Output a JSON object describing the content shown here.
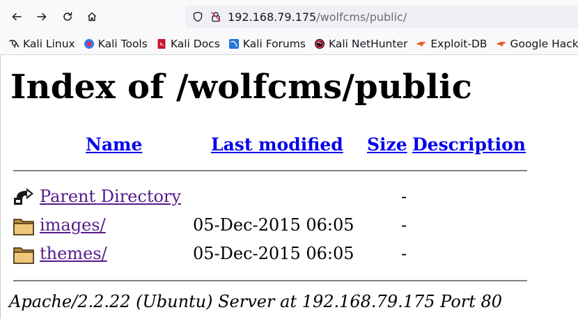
{
  "browser": {
    "url_host": "192.168.79.175",
    "url_path": "/wolfcms/public/",
    "bookmarks": [
      {
        "label": "Kali Linux",
        "icon": "kali-dragon-icon"
      },
      {
        "label": "Kali Tools",
        "icon": "kali-tools-icon"
      },
      {
        "label": "Kali Docs",
        "icon": "kali-docs-icon"
      },
      {
        "label": "Kali Forums",
        "icon": "kali-forums-icon"
      },
      {
        "label": "Kali NetHunter",
        "icon": "kali-nethunter-icon"
      },
      {
        "label": "Exploit-DB",
        "icon": "exploit-db-icon"
      },
      {
        "label": "Google Hack",
        "icon": "google-hacking-icon"
      }
    ]
  },
  "page": {
    "title": "Index of /wolfcms/public",
    "columns": {
      "name": "Name",
      "last_modified": "Last modified",
      "size": "Size",
      "description": "Description"
    },
    "rows": [
      {
        "name": "Parent Directory",
        "modified": "",
        "size": "-",
        "icon": "back-arrow-icon"
      },
      {
        "name": "images/",
        "modified": "05-Dec-2015 06:05",
        "size": "-",
        "icon": "folder-icon"
      },
      {
        "name": "themes/",
        "modified": "05-Dec-2015 06:05",
        "size": "-",
        "icon": "folder-icon"
      }
    ],
    "address": "Apache/2.2.22 (Ubuntu) Server at 192.168.79.175 Port 80"
  },
  "colors": {
    "link": "#0000ee",
    "visited_link": "#551a8b",
    "folder": "#f0c77a"
  }
}
